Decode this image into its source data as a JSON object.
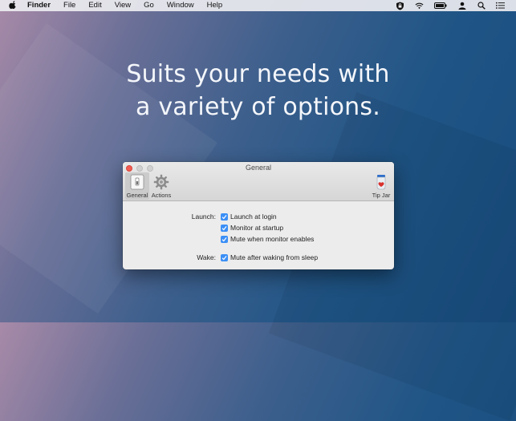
{
  "menubar": {
    "app_name": "Finder",
    "items": [
      "File",
      "Edit",
      "View",
      "Go",
      "Window",
      "Help"
    ],
    "status_icons": [
      "shield-icon",
      "wifi-icon",
      "battery-icon",
      "user-icon",
      "search-icon",
      "list-icon"
    ]
  },
  "headline": {
    "line1": "Suits your needs with",
    "line2": "a variety of options."
  },
  "window": {
    "title": "General",
    "toolbar": {
      "general": "General",
      "actions": "Actions",
      "tip_jar": "Tip Jar"
    },
    "launch": {
      "label": "Launch:",
      "options": [
        {
          "label": "Launch at login",
          "checked": true
        },
        {
          "label": "Monitor at startup",
          "checked": true
        },
        {
          "label": "Mute when monitor enables",
          "checked": true
        }
      ]
    },
    "wake": {
      "label": "Wake:",
      "options": [
        {
          "label": "Mute after waking from sleep",
          "checked": true
        }
      ]
    }
  },
  "colors": {
    "checkbox": "#3b8ff6",
    "close_button": "#f45c52"
  }
}
